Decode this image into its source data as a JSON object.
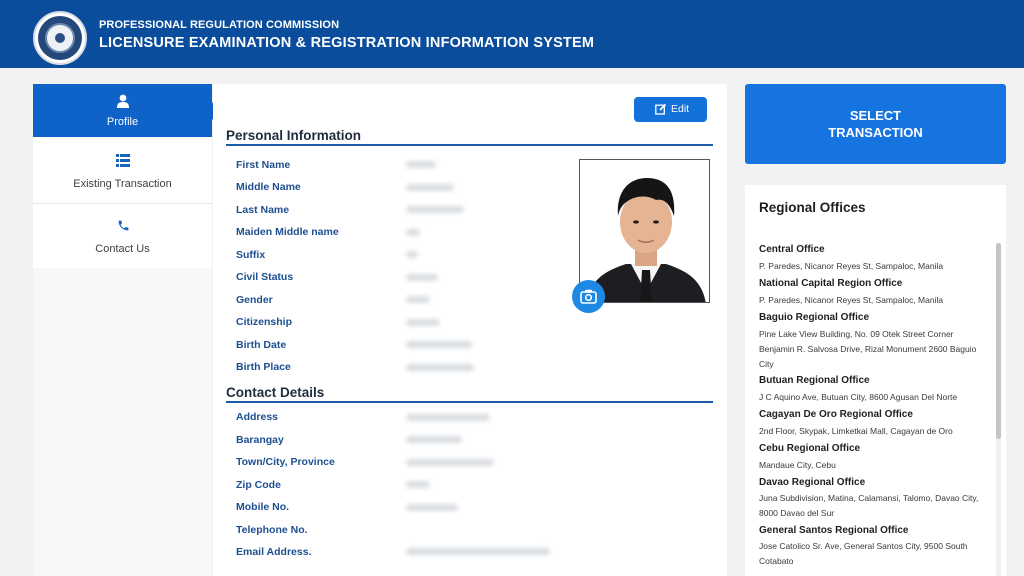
{
  "header": {
    "org_name": "PROFESSIONAL REGULATION COMMISSION",
    "system_name": "LICENSURE EXAMINATION & REGISTRATION INFORMATION SYSTEM",
    "bg_color": "#0a4d9c"
  },
  "sidebar": {
    "items": [
      {
        "label": "Profile",
        "icon": "user-icon",
        "active": true
      },
      {
        "label": "Existing Transaction",
        "icon": "list-icon",
        "active": false
      },
      {
        "label": "Contact Us",
        "icon": "phone-icon",
        "active": false
      }
    ],
    "active_color": "#0f62c8"
  },
  "profile": {
    "edit_label": "Edit",
    "personal_title": "Personal Information",
    "personal_fields": [
      {
        "label": "First Name"
      },
      {
        "label": "Middle Name"
      },
      {
        "label": "Last Name"
      },
      {
        "label": "Maiden Middle name"
      },
      {
        "label": "Suffix"
      },
      {
        "label": "Civil Status"
      },
      {
        "label": "Gender"
      },
      {
        "label": "Citizenship"
      },
      {
        "label": "Birth Date"
      },
      {
        "label": "Birth Place"
      }
    ],
    "contact_title": "Contact Details",
    "contact_fields": [
      {
        "label": "Address"
      },
      {
        "label": "Barangay"
      },
      {
        "label": "Town/City, Province"
      },
      {
        "label": "Zip Code"
      },
      {
        "label": "Mobile No."
      },
      {
        "label": "Telephone No."
      },
      {
        "label": "Email Address."
      }
    ]
  },
  "transaction_button": {
    "line1": "SELECT",
    "line2": "TRANSACTION",
    "color": "#1574e0"
  },
  "regional_offices": {
    "title": "Regional Offices",
    "offices": [
      {
        "name": "Central Office",
        "address": "P. Paredes, Nicanor Reyes St, Sampaloc, Manila"
      },
      {
        "name": "National Capital Region Office",
        "address": "P. Paredes, Nicanor Reyes St, Sampaloc, Manila"
      },
      {
        "name": "Baguio Regional Office",
        "address": "Pine Lake View Building, No. 09 Otek Street Corner Benjamin R. Salvosa Drive, Rizal Monument 2600 Baguio City"
      },
      {
        "name": "Butuan Regional Office",
        "address": "J C Aquino Ave, Butuan City, 8600 Agusan Del Norte"
      },
      {
        "name": "Cagayan De Oro Regional Office",
        "address": "2nd Floor, Skypak, Limketkai Mall, Cagayan de Oro"
      },
      {
        "name": "Cebu Regional Office",
        "address": "Mandaue City, Cebu"
      },
      {
        "name": "Davao Regional Office",
        "address": "Juna Subdivision, Matina, Calamansi, Talomo, Davao City, 8000 Davao del Sur"
      },
      {
        "name": "General Santos Regional Office",
        "address": "Jose Catolico Sr. Ave, General Santos City, 9500 South Cotabato"
      }
    ]
  }
}
